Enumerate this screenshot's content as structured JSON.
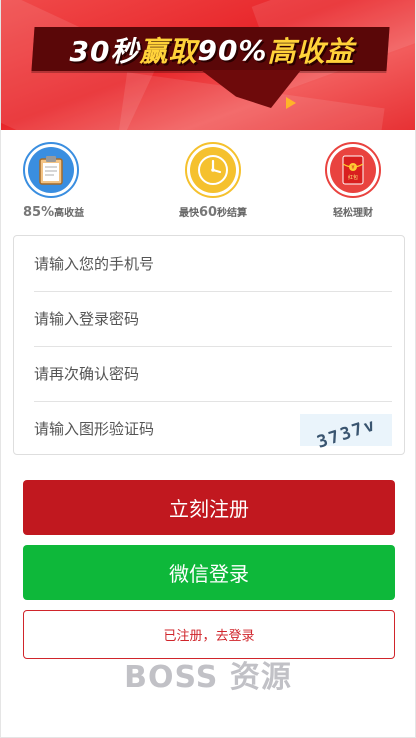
{
  "banner": {
    "title_part1": "30秒",
    "title_part2": "赢取",
    "title_part3": "90%",
    "title_part4": "高收益",
    "colors": {
      "background": "#e8262a",
      "ribbon": "#5a0708",
      "highlight": "#ffd23a"
    }
  },
  "features": [
    {
      "icon": "clipboard-icon",
      "value": "85%",
      "label": "高收益",
      "color": "#3a8ee0"
    },
    {
      "icon": "clock-icon",
      "prefix": "最快",
      "value": "60",
      "label": "秒结算",
      "color": "#f5c12e"
    },
    {
      "icon": "red-envelope-icon",
      "label": "轻松理财",
      "envelope_text": "红包",
      "color": "#e9433f"
    }
  ],
  "form": {
    "phone_placeholder": "请输入您的手机号",
    "password_placeholder": "请输入登录密码",
    "confirm_placeholder": "请再次确认密码",
    "captcha_placeholder": "请输入图形验证码",
    "captcha_text": "3737v"
  },
  "buttons": {
    "register": "立刻注册",
    "wechat_login": "微信登录",
    "already_registered": "已注册，去登录"
  },
  "watermark": "BOSS 资源",
  "colors": {
    "primary_red": "#c1181f",
    "wechat_green": "#0eb83a"
  }
}
